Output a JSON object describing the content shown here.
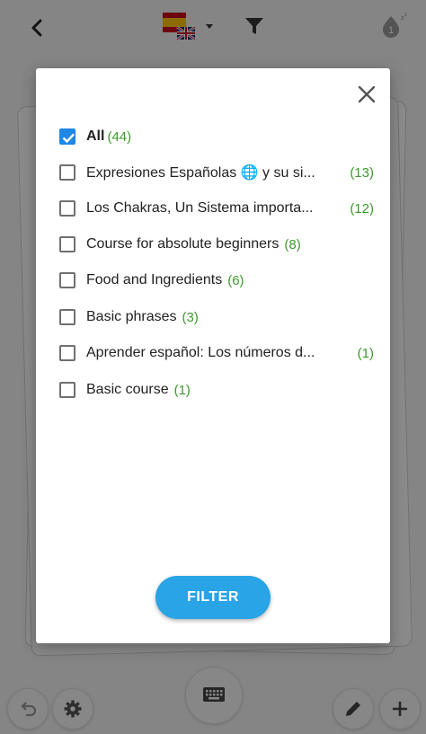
{
  "header": {
    "language_flag_icon": "spain-uk-flag-icon",
    "language_dropdown_icon": "caret-down-icon",
    "filter_icon": "filter-funnel-icon",
    "badge_count": "1"
  },
  "dialog": {
    "close_icon": "close-icon",
    "all_item": {
      "label": "All",
      "count": "(44)",
      "checked": true
    },
    "items": [
      {
        "label": "Expresiones Españolas 🌐 y su si...",
        "count": "(13)"
      },
      {
        "label": "Los Chakras, Un Sistema importa...",
        "count": "(12)"
      },
      {
        "label": "Course for absolute beginners",
        "count": "(8)"
      },
      {
        "label": "Food and Ingredients",
        "count": "(6)"
      },
      {
        "label": "Basic phrases",
        "count": "(3)"
      },
      {
        "label": "Aprender español: Los números d...",
        "count": "(1)"
      },
      {
        "label": "Basic course",
        "count": "(1)"
      }
    ],
    "filter_button_label": "FILTER"
  },
  "bottom_bar": {
    "undo_icon": "undo-icon",
    "settings_icon": "gear-icon",
    "keyboard_icon": "keyboard-icon",
    "edit_icon": "pencil-icon",
    "add_icon": "plus-icon"
  },
  "colors": {
    "accent_blue": "#29a4e6",
    "checkbox_blue": "#1e88e5",
    "count_green": "#3b9a2c"
  }
}
